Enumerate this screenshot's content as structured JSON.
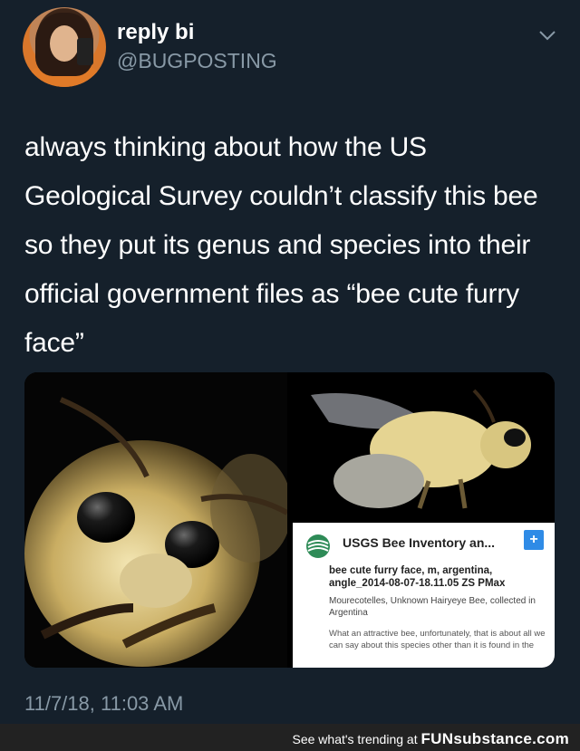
{
  "tweet": {
    "display_name": "reply bi",
    "handle": "@BUGPOSTING",
    "text": "always thinking about how the US Geological Survey couldn’t classify this bee so they put its genus and species into their official government files as “bee cute furry face”",
    "timestamp": "11/7/18, 11:03 AM"
  },
  "media": {
    "usgs_card": {
      "title": "USGS Bee Inventory an...",
      "plus": "+",
      "heading": "bee cute furry face, m, argentina, angle_2014-08-07-18.11.05 ZS PMax",
      "description": "Mourecotelles, Unknown Hairyeye Bee, collected in Argentina",
      "description2": "What an attractive bee, unfortunately, that is about all we can say about this species other than it is found in the"
    }
  },
  "footer": {
    "prefix": "See what's trending at ",
    "brand": "FUNsubstance.com"
  },
  "colors": {
    "background": "#15202b",
    "secondary_text": "#8899a6",
    "usgs_accent": "#2f8be6",
    "footer_bg": "#222222"
  }
}
